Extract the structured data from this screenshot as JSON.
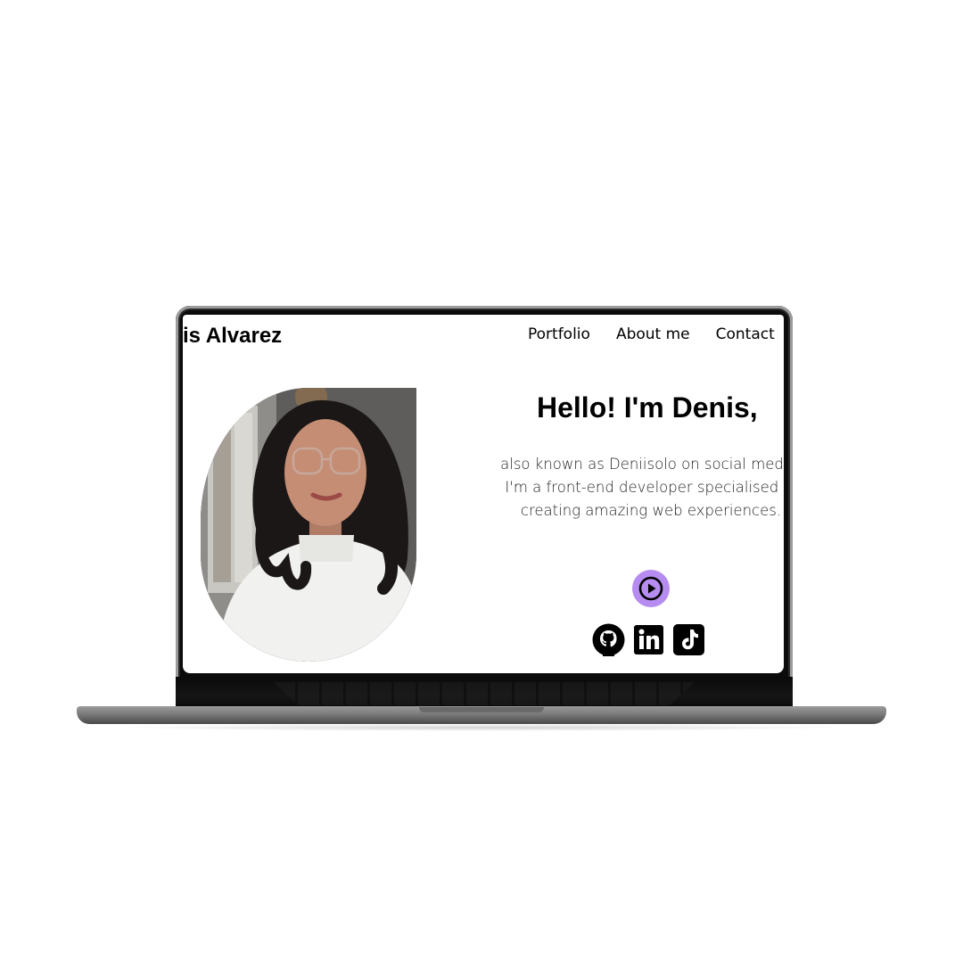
{
  "site": {
    "brand": "enis Alvarez",
    "nav": {
      "items": [
        {
          "label": "Portfolio"
        },
        {
          "label": "About me"
        },
        {
          "label": "Contact"
        }
      ]
    },
    "hero": {
      "title": "Hello! I'm Denis,",
      "text": "also known as Deniisolo on social media. I'm a front-end developer specialised in creating amazing web experiences.",
      "play_icon": "play-circle-icon",
      "socials": [
        {
          "icon": "github-icon"
        },
        {
          "icon": "linkedin-icon"
        },
        {
          "icon": "tiktok-icon"
        }
      ]
    },
    "colors": {
      "accent": "#b68cf0",
      "text": "#000000",
      "background": "#ffffff"
    }
  }
}
